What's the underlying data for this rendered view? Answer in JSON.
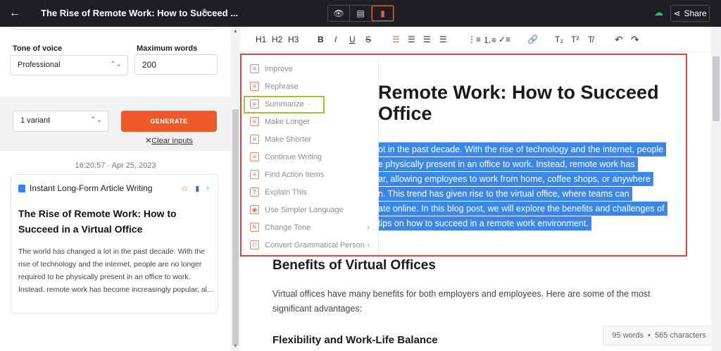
{
  "topbar": {
    "title": "The Rise of Remote Work: How to Succeed ...",
    "share_label": "Share"
  },
  "form": {
    "tone_label": "Tone of voice",
    "tone_value": "Professional",
    "max_words_label": "Maximum words",
    "max_words_value": "200",
    "variant_value": "1 variant",
    "generate_label": "GENERATE",
    "clear_label": "Clear inputs"
  },
  "history": {
    "timestamp": "16:20:57 · Apr 25, 2023",
    "card_template": "Instant Long-Form Article Writing",
    "card_title": "The Rise of Remote Work: How to Succeed in a Virtual Office",
    "card_body": "The world has changed a lot in the past decade. With the rise of technology and the internet, people are no longer required to be physically present in an office to work. Instead, remote work has become increasingly popular, al..."
  },
  "toolbar": {
    "h1": "H1",
    "h2": "H2",
    "h3": "H3",
    "bold": "B",
    "italic": "I",
    "underline": "U",
    "strike": "S",
    "subscript": "T₂",
    "superscript": "T²",
    "clear_format": "T̸"
  },
  "document": {
    "title_line1": "Remote Work: How to Succeed",
    "title_line2": "Office",
    "highlight_lines": [
      "ot in the past decade. With the rise of technology and the internet, people",
      "e physically present in an office to work. Instead, remote work has",
      "ar, allowing employees to work from home, coffee shops, or anywhere",
      "n. This trend has given rise to the virtual office, where teams can",
      "ate online. In this blog post, we will explore the benefits and challenges of",
      "tips on how to succeed in a remote work environment."
    ],
    "heading_benefits": "Benefits of Virtual Offices",
    "para_benefits": "Virtual offices have many benefits for both employers and employees. Here are some of the most significant advantages:",
    "heading_flex": "Flexibility and Work-Life Balance"
  },
  "ai_menu": {
    "items": [
      {
        "label": "Improve",
        "icon": "≡"
      },
      {
        "label": "Rephrase",
        "icon": "≡"
      },
      {
        "label": "Summarize",
        "icon": "≡",
        "suffix": "·"
      },
      {
        "label": "Make Longer",
        "icon": "≡"
      },
      {
        "label": "Make Shorter",
        "icon": "≡"
      },
      {
        "label": "Continue Writing",
        "icon": "≡"
      },
      {
        "label": "Find Action Items",
        "icon": "≡"
      },
      {
        "label": "Explain This",
        "icon": "?"
      },
      {
        "label": "Use Simpler Language",
        "icon": "◉"
      },
      {
        "label": "Change Tone",
        "icon": "✎",
        "suffix": "›"
      },
      {
        "label": "Convert Grammatical Person",
        "icon": "⚇",
        "suffix": "›"
      }
    ]
  },
  "stats": {
    "words": "95 words",
    "characters": "565 characters"
  }
}
